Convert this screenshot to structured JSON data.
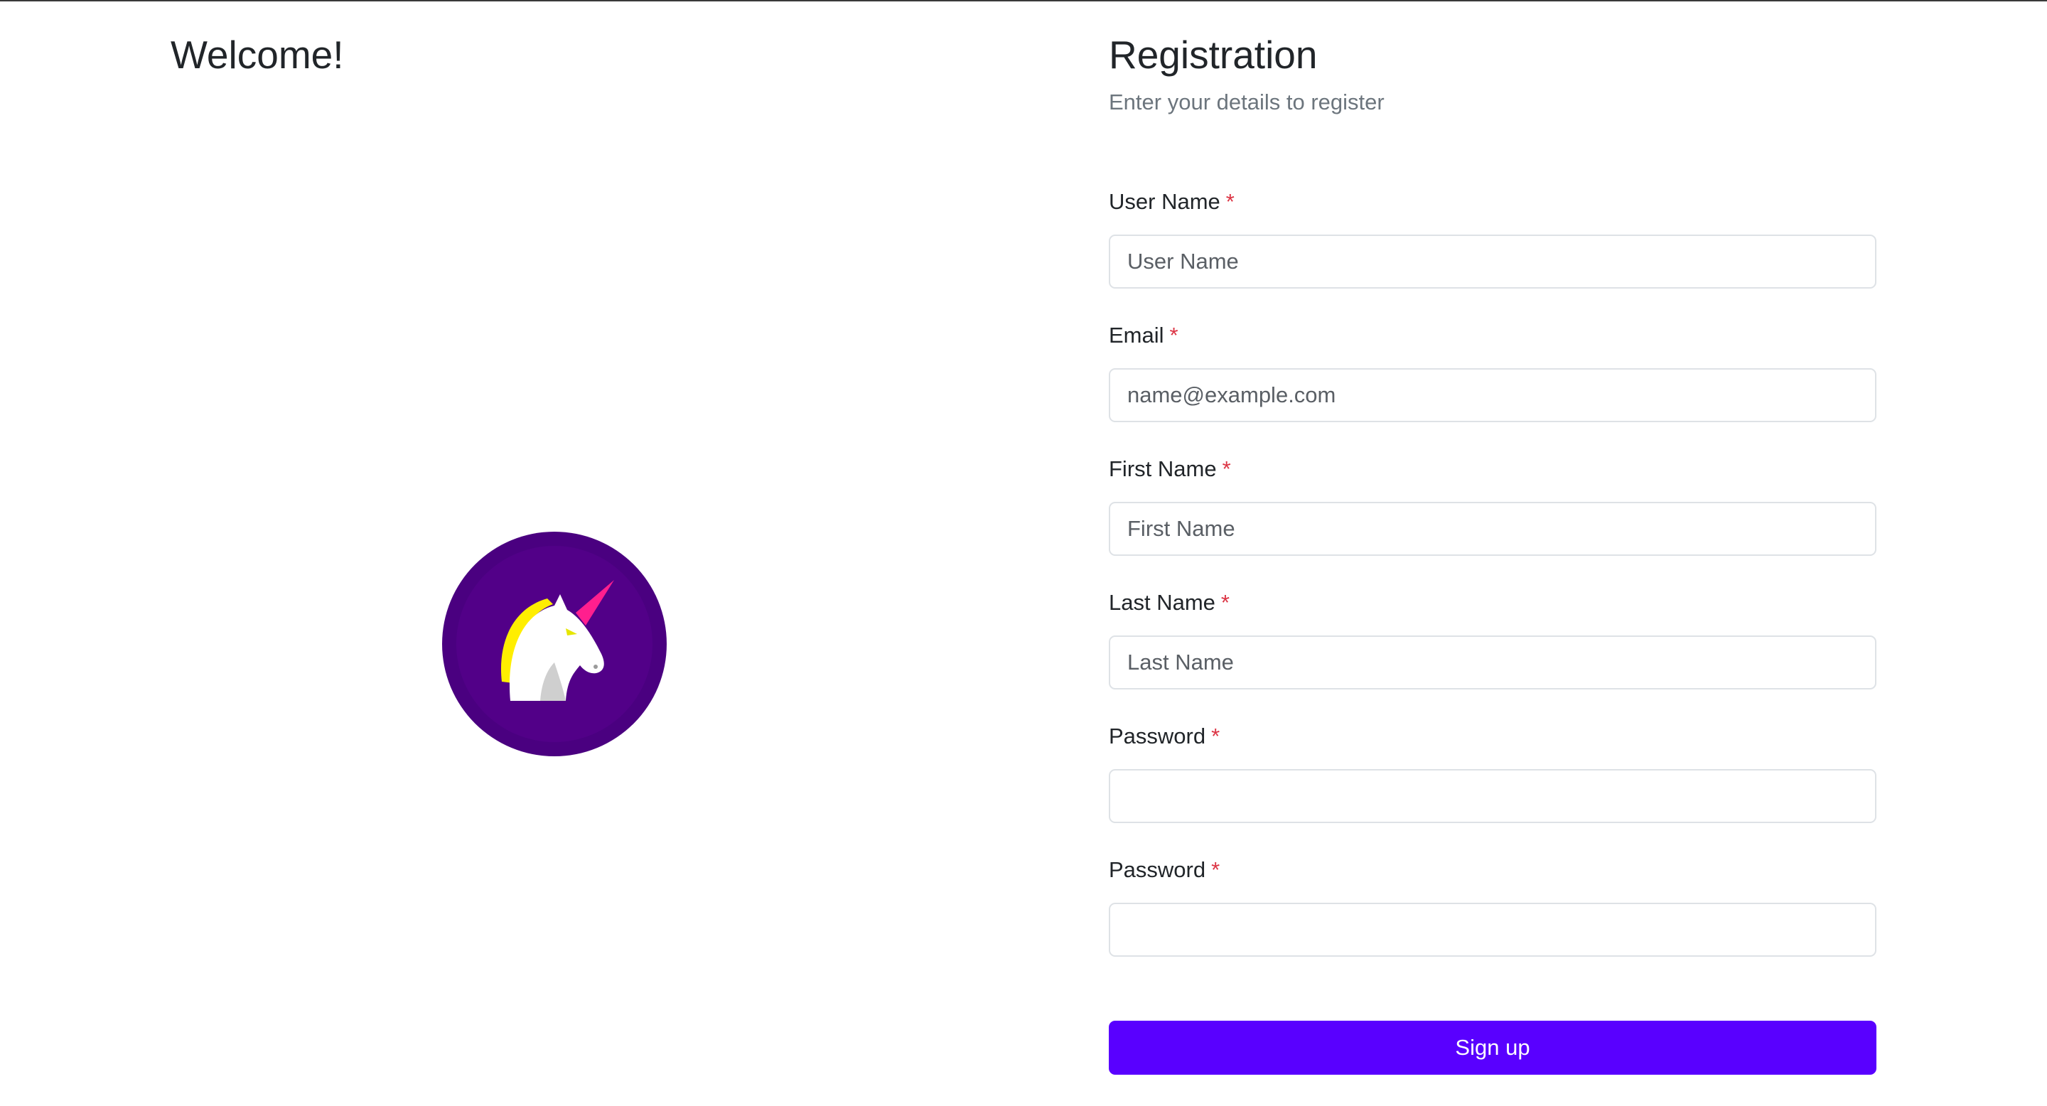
{
  "welcome": {
    "title": "Welcome!",
    "logo_icon": "unicorn-logo-icon"
  },
  "registration": {
    "title": "Registration",
    "subtitle": "Enter your details to register",
    "required_marker": "*",
    "fields": [
      {
        "label": "User Name",
        "placeholder": "User Name",
        "value": "",
        "type": "text"
      },
      {
        "label": "Email",
        "placeholder": "name@example.com",
        "value": "",
        "type": "email"
      },
      {
        "label": "First Name",
        "placeholder": "First Name",
        "value": "",
        "type": "text"
      },
      {
        "label": "Last Name",
        "placeholder": "Last Name",
        "value": "",
        "type": "text"
      },
      {
        "label": "Password",
        "placeholder": "",
        "value": "",
        "type": "password"
      },
      {
        "label": "Password",
        "placeholder": "",
        "value": "",
        "type": "password"
      }
    ],
    "submit_label": "Sign up"
  },
  "colors": {
    "accent": "#5900ff",
    "logo_background": "#4a0080",
    "required": "#dc3545",
    "subtitle": "#6c757d"
  }
}
